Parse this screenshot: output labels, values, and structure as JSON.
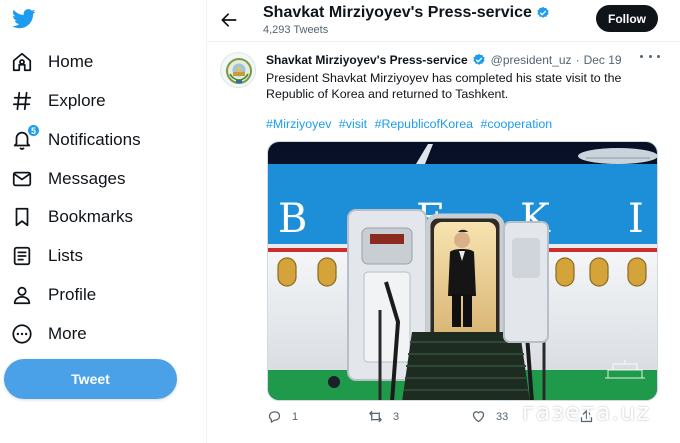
{
  "nav": {
    "logo": "twitter-bird-icon",
    "items": [
      {
        "label": "Home",
        "icon": "home-icon"
      },
      {
        "label": "Explore",
        "icon": "hashtag-icon"
      },
      {
        "label": "Notifications",
        "icon": "bell-icon",
        "badge": "5"
      },
      {
        "label": "Messages",
        "icon": "envelope-icon"
      },
      {
        "label": "Bookmarks",
        "icon": "bookmark-icon"
      },
      {
        "label": "Lists",
        "icon": "list-icon"
      },
      {
        "label": "Profile",
        "icon": "person-icon"
      },
      {
        "label": "More",
        "icon": "more-circle-icon"
      }
    ],
    "tweet_button": "Tweet"
  },
  "header": {
    "title": "Shavkat Mirziyoyev's Press-service",
    "subtitle": "4,293 Tweets",
    "follow_label": "Follow"
  },
  "tweet": {
    "author_name": "Shavkat Mirziyoyev's Press-service",
    "handle": "@president_uz",
    "separator": "·",
    "date": "Dec 19",
    "text": "President Shavkat Mirziyoyev has completed his state visit to the Republic of Korea and returned to Tashkent.",
    "hashtags": [
      "#Mirziyoyev",
      "#visit",
      "#RepublicofKorea",
      "#cooperation"
    ],
    "fuselage_letters": [
      "B",
      "E",
      "K",
      "I"
    ],
    "replies": "1",
    "retweets": "3",
    "likes": "33"
  },
  "watermark": "газета.uz",
  "colors": {
    "accent": "#1d9bf0",
    "tweet_button": "#4aa1e8",
    "text": "#0f1419",
    "secondary": "#536471"
  }
}
